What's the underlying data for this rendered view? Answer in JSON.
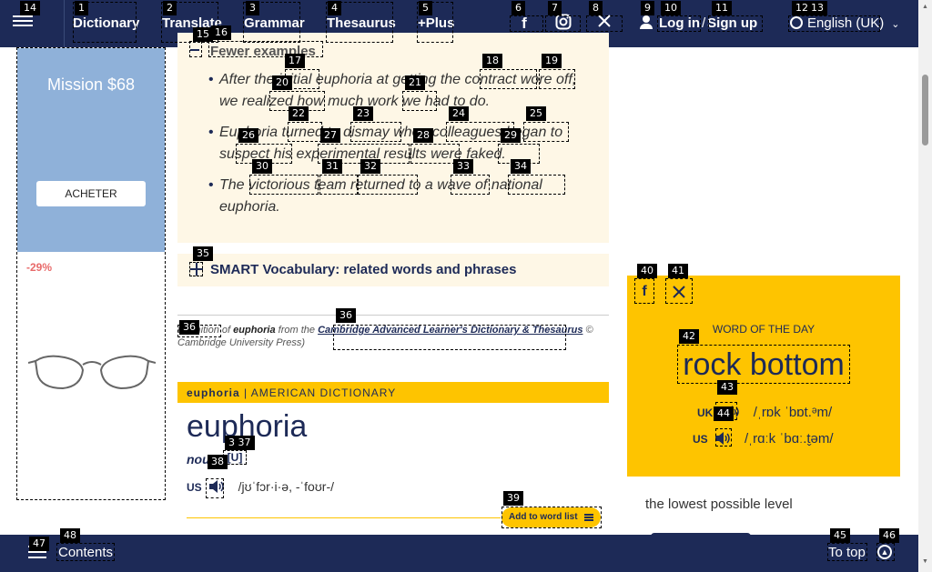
{
  "nav": {
    "links": [
      "Dictionary",
      "Translate",
      "Grammar",
      "Thesaurus",
      "+Plus"
    ],
    "login": "Log in",
    "signup": "Sign up",
    "separator": "/",
    "language": "English (UK)",
    "social_icons": [
      "facebook-icon",
      "instagram-icon",
      "x-icon"
    ]
  },
  "ad": {
    "mission": "Mission $68",
    "button": "ACHETER",
    "discount": "-29%"
  },
  "examples": {
    "heading": "Fewer examples",
    "items": [
      "After the initial euphoria at getting the contract wore off, we realized how much work we had to do.",
      "Euphoria turned to dismay when colleagues began to suspect his experimental results were faked.",
      "The victorious team returned to a wave of national euphoria."
    ]
  },
  "smart_vocab": "SMART Vocabulary: related words and phrases",
  "credit": {
    "prefix": "Definition of",
    "word": "euphoria",
    "from": "from the",
    "source": "Cambridge Advanced Learner's Dictionary & Thesaurus",
    "copyright": "© Cambridge University Press)"
  },
  "american": {
    "bar_word": "euphoria",
    "bar_label": "AMERICAN DICTIONARY",
    "headword": "euphoria",
    "pos": "noun",
    "count": "[U]",
    "pron_region": "US",
    "pron": "/jʊˈfɔr·i·ə, -ˈfoʊr-/",
    "add_button": "Add to word list"
  },
  "wotd": {
    "title": "WORD OF THE DAY",
    "word": "rock bottom",
    "uk_region": "UK",
    "uk_pron": "/ˌrɒk ˈbɒt.ᵊm/",
    "us_region": "US",
    "us_pron": "/ˌrɑːk ˈbɑː.t̬əm/",
    "definition": "the lowest possible level"
  },
  "bottom": {
    "contents": "Contents",
    "to_top": "To top"
  },
  "badges": [
    "14",
    "1",
    "2",
    "3",
    "4",
    "5",
    "6",
    "7",
    "8",
    "9",
    "10",
    "11",
    "12",
    "13",
    "15",
    "16",
    "17",
    "18",
    "19",
    "20",
    "21",
    "22",
    "23",
    "24",
    "25",
    "26",
    "27",
    "28",
    "29",
    "30",
    "31",
    "32",
    "33",
    "34",
    "35",
    "36",
    "36",
    "3 37",
    "38",
    "39",
    "40",
    "41",
    "42",
    "43",
    "44",
    "45",
    "46",
    "47",
    "48"
  ],
  "colors": {
    "navy": "#1d2a57",
    "amber": "#fec400",
    "cream": "#fef7e6"
  }
}
